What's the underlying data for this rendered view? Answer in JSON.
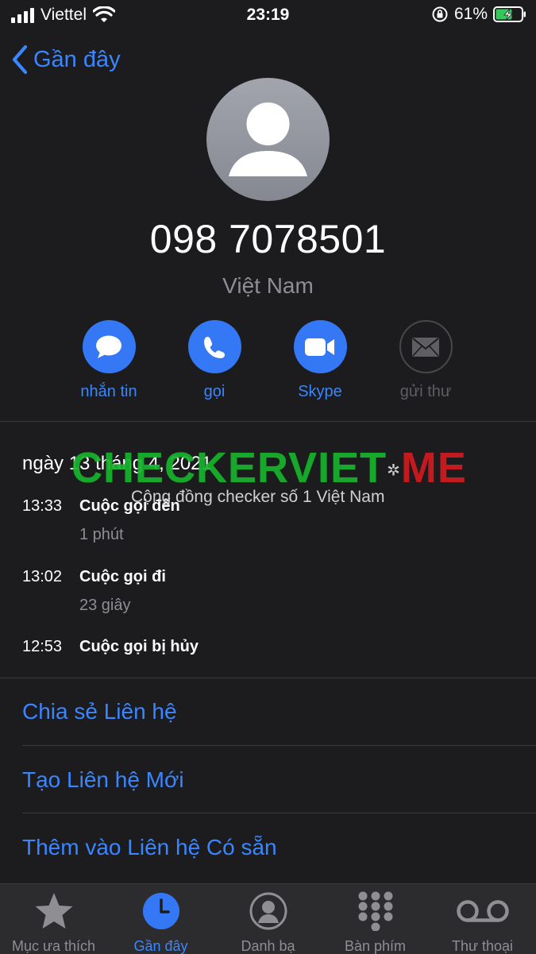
{
  "status_bar": {
    "carrier": "Viettel",
    "time": "23:19",
    "battery_percent": "61%"
  },
  "nav": {
    "back_label": "Gần đây"
  },
  "contact": {
    "phone_number": "098 7078501",
    "country": "Việt Nam"
  },
  "actions": [
    {
      "label": "nhắn tin",
      "icon": "message-icon",
      "enabled": true
    },
    {
      "label": "gọi",
      "icon": "phone-icon",
      "enabled": true
    },
    {
      "label": "Skype",
      "icon": "video-icon",
      "enabled": true
    },
    {
      "label": "gửi thư",
      "icon": "mail-icon",
      "enabled": false
    }
  ],
  "history": {
    "date": "ngày 13 tháng 4, 2021",
    "calls": [
      {
        "time": "13:33",
        "type": "Cuộc gọi đến",
        "duration": "1 phút"
      },
      {
        "time": "13:02",
        "type": "Cuộc gọi đi",
        "duration": "23 giây"
      },
      {
        "time": "12:53",
        "type": "Cuộc gọi bị hủy",
        "duration": ""
      }
    ]
  },
  "watermark": {
    "logo_main": "CHECKERVIET",
    "logo_dot": "✲",
    "logo_suffix": "ME",
    "tagline": "Cộng đồng checker số 1 Việt Nam"
  },
  "links": [
    {
      "label": "Chia sẻ Liên hệ"
    },
    {
      "label": "Tạo Liên hệ Mới"
    },
    {
      "label": "Thêm vào Liên hệ Có sẵn"
    }
  ],
  "tabs": [
    {
      "label": "Mục ưa thích",
      "icon": "star-icon",
      "active": false
    },
    {
      "label": "Gần đây",
      "icon": "clock-icon",
      "active": true
    },
    {
      "label": "Danh bạ",
      "icon": "person-circle-icon",
      "active": false
    },
    {
      "label": "Bàn phím",
      "icon": "keypad-icon",
      "active": false
    },
    {
      "label": "Thư thoại",
      "icon": "voicemail-icon",
      "active": false
    }
  ],
  "colors": {
    "background": "#1c1c1e",
    "accent": "#3478f6",
    "secondary_text": "#8e8e93",
    "tabbar": "#2c2c2e"
  }
}
